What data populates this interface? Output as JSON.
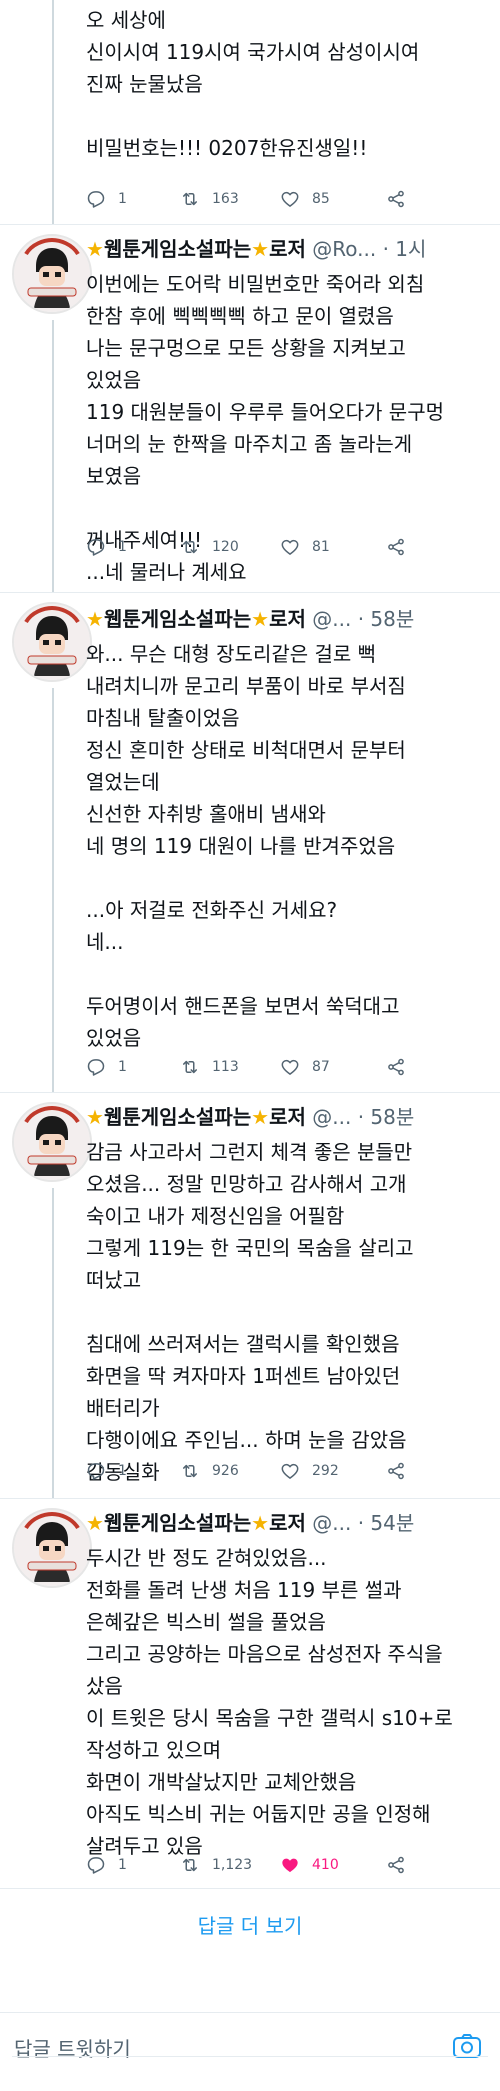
{
  "colors": {
    "text": "#0f1419",
    "muted": "#536471",
    "accent": "#1d9bf0",
    "like": "#f91880",
    "star": "#f5b301"
  },
  "tweet0": {
    "body": "오 세상에\n신이시여 119시여 국가시여 삼성이시여\n진짜 눈물났음\n\n비밀번호는!!! 0207한유진생일!!",
    "reply": "1",
    "retweet": "163",
    "like": "85"
  },
  "tweet1": {
    "name": "웹툰게임소설파는",
    "name2": "로저",
    "handle": "@Ro...",
    "time": "· 1시",
    "body": "이번에는 도어락 비밀번호만 죽어라 외침\n한참 후에 삑삑삑삑 하고 문이 열렸음\n나는 문구멍으로 모든 상황을 지켜보고\n있었음\n119 대원분들이 우루루 들어오다가 문구멍\n너머의 눈 한짝을 마주치고 좀 놀라는게\n보였음\n\n꺼내주세여!!!\n...네 물러나 계세요",
    "reply": "1",
    "retweet": "120",
    "like": "81"
  },
  "tweet2": {
    "name": "웹툰게임소설파는",
    "name2": "로저",
    "handle": "@...",
    "time": "· 58분",
    "body": "와... 무슨 대형 장도리같은 걸로 뻑\n내려치니까 문고리 부품이 바로 부서짐\n마침내 탈출이었음\n정신 혼미한 상태로 비척대면서 문부터\n열었는데\n신선한 자취방 홀애비 냄새와\n네 명의 119 대원이 나를 반겨주었음\n\n...아 저걸로 전화주신 거세요?\n네...\n\n두어명이서 핸드폰을 보면서 쑥덕대고\n있었음",
    "reply": "1",
    "retweet": "113",
    "like": "87"
  },
  "tweet3": {
    "name": "웹툰게임소설파는",
    "name2": "로저",
    "handle": "@...",
    "time": "· 58분",
    "body": "감금 사고라서 그런지 체격 좋은 분들만\n오셨음... 정말 민망하고 감사해서 고개\n숙이고 내가 제정신임을 어필함\n그렇게 119는 한 국민의 목숨을 살리고\n떠났고\n\n침대에 쓰러져서는 갤럭시를 확인했음\n화면을 딱 켜자마자 1퍼센트 남아있던\n배터리가\n다행이에요 주인님... 하며 눈을 감았음\n감동실화",
    "reply": "1",
    "retweet": "926",
    "like": "292"
  },
  "tweet4": {
    "name": "웹툰게임소설파는",
    "name2": "로저",
    "handle": "@...",
    "time": "· 54분",
    "body": "두시간 반 정도 갇혀있었음...\n전화를 돌려 난생 처음 119 부른 썰과\n은혜갚은 빅스비 썰을 풀었음\n그리고 공양하는 마음으로 삼성전자 주식을\n샀음\n이 트윗은 당시 목숨을 구한 갤럭시 s10+로\n작성하고 있으며\n화면이 개박살났지만 교체안했음\n아직도 빅스비 귀는 어둡지만 공을 인정해\n살려두고 있음",
    "reply": "1",
    "retweet": "1,123",
    "like": "410"
  },
  "more_replies": "답글 더 보기",
  "reply_placeholder": "답글 트윗하기",
  "icons": [
    "reply-icon",
    "retweet-icon",
    "like-icon",
    "share-icon",
    "camera-icon",
    "star-icon"
  ]
}
